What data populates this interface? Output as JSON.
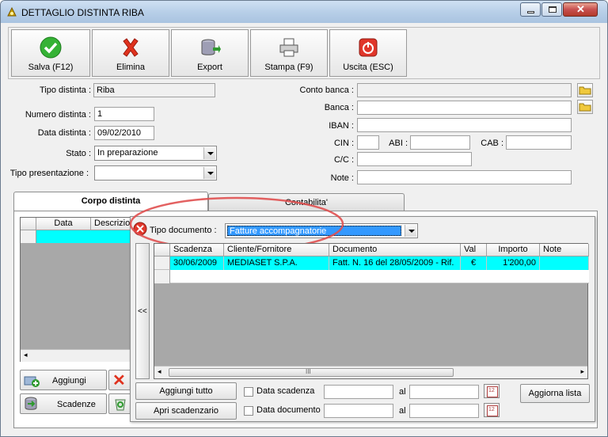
{
  "window": {
    "title": "DETTAGLIO DISTINTA RIBA"
  },
  "toolbar": {
    "save": "Salva (F12)",
    "delete": "Elimina",
    "export": "Export",
    "print": "Stampa (F9)",
    "exit": "Uscita (ESC)"
  },
  "form": {
    "tipo_distinta_label": "Tipo distinta :",
    "tipo_distinta_value": "Riba",
    "numero_label": "Numero distinta :",
    "numero_value": "1",
    "data_label": "Data distinta :",
    "data_value": "09/02/2010",
    "stato_label": "Stato :",
    "stato_value": "In preparazione",
    "tipo_pres_label": "Tipo presentazione :",
    "tipo_pres_value": "",
    "conto_banca_label": "Conto banca :",
    "banca_label": "Banca :",
    "iban_label": "IBAN :",
    "cin_label": "CIN :",
    "abi_label": "ABI :",
    "cab_label": "CAB :",
    "cc_label": "C/C :",
    "note_label": "Note :"
  },
  "tabs": {
    "corpo": "Corpo distinta",
    "contabilita": "Contabilita'"
  },
  "left_grid": {
    "col_data": "Data",
    "col_descr": "Descrizio"
  },
  "left_buttons": {
    "aggiungi": "Aggiungi",
    "scadenze": "Scadenze"
  },
  "popup": {
    "tipo_doc_label": "Tipo documento :",
    "tipo_doc_value": "Fatture accompagnatorie",
    "collapse": "<<",
    "headers": [
      "Scadenza",
      "Cliente/Fornitore",
      "Documento",
      "Val",
      "Importo",
      "Note"
    ],
    "rows": [
      {
        "scadenza": "30/06/2009",
        "cliente": "MEDIASET S.P.A.",
        "documento": "Fatt. N. 16 del 28/05/2009 - Rif.",
        "val": "€",
        "importo": "1'200,00",
        "note": ""
      }
    ],
    "scroll_grip": "III",
    "aggiungi_tutto": "Aggiungi tutto",
    "apri_scadenzario": "Apri scadenzario",
    "data_scadenza": "Data scadenza",
    "data_documento": "Data documento",
    "al1": "al",
    "al2": "al",
    "aggiorna": "Aggiorna lista"
  },
  "colors": {
    "selected_row": "#00ffff",
    "highlight_ring": "#e05050",
    "combo_selected": "#3399ff"
  }
}
